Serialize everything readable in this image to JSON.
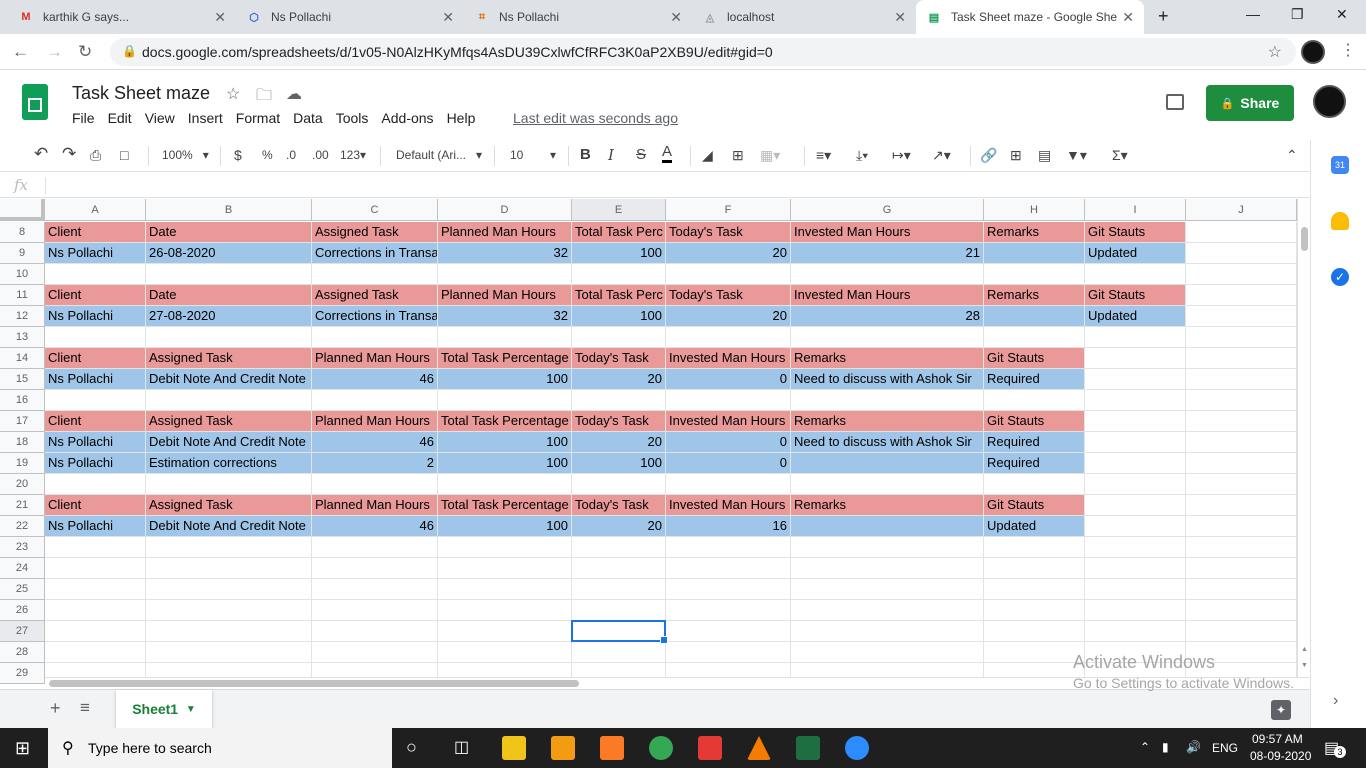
{
  "browser": {
    "tabs": [
      {
        "title": "karthik G says...",
        "fav": "M",
        "favcolor": "#d93025"
      },
      {
        "title": "Ns Pollachi",
        "fav": "⬡",
        "favcolor": "#3367d6"
      },
      {
        "title": "Ns Pollachi",
        "fav": "⌗",
        "favcolor": "#e8710a"
      },
      {
        "title": "localhost",
        "fav": "◬",
        "favcolor": "#9aa0a6"
      },
      {
        "title": "Task Sheet maze - Google She",
        "fav": "▤",
        "favcolor": "#0f9d58"
      }
    ],
    "url": "docs.google.com/spreadsheets/d/1v05-N0AlzHKyMfqs4AsDU39CxlwfCfRFC3K0aP2XB9U/edit#gid=0"
  },
  "app": {
    "title": "Task Sheet maze",
    "menu": [
      "File",
      "Edit",
      "View",
      "Insert",
      "Format",
      "Data",
      "Tools",
      "Add-ons",
      "Help"
    ],
    "last_edit": "Last edit was seconds ago",
    "share_label": "Share"
  },
  "toolbar": {
    "zoom": "100%",
    "currency": "$",
    "percent": "%",
    "dec_less": ".0",
    "dec_more": ".00",
    "num_format": "123",
    "font": "Default (Ari...",
    "font_size": "10",
    "bold": "B",
    "italic": "I",
    "strike": "S",
    "text_color": "A"
  },
  "formula_bar": {
    "label": "fx",
    "value": ""
  },
  "columns": [
    "A",
    "B",
    "C",
    "D",
    "E",
    "F",
    "G",
    "H",
    "I",
    "J"
  ],
  "rows": [
    {
      "n": "8",
      "style": "pink9",
      "cells": [
        "Client",
        "Date",
        "Assigned Task",
        "Planned Man Hours",
        "Total Task Perc",
        "Today's Task",
        "Invested Man Hours",
        "Remarks",
        "Git Stauts"
      ]
    },
    {
      "n": "9",
      "style": "blue9",
      "cells": [
        "Ns Pollachi",
        "26-08-2020",
        "Corrections in Transa",
        "32",
        "100",
        "20",
        "21",
        "",
        "Updated"
      ]
    },
    {
      "n": "10",
      "style": "empty",
      "cells": []
    },
    {
      "n": "11",
      "style": "pink9",
      "cells": [
        "Client",
        "Date",
        "Assigned Task",
        "Planned Man Hours",
        "Total Task Perc",
        "Today's Task",
        "Invested Man Hours",
        "Remarks",
        "Git Stauts"
      ]
    },
    {
      "n": "12",
      "style": "blue9",
      "cells": [
        "Ns Pollachi",
        "27-08-2020",
        "Corrections in Transa",
        "32",
        "100",
        "20",
        "28",
        "",
        "Updated"
      ]
    },
    {
      "n": "13",
      "style": "empty",
      "cells": []
    },
    {
      "n": "14",
      "style": "pink8",
      "cells": [
        "Client",
        "Assigned Task",
        "Planned Man Hours",
        "Total Task Percentage",
        "Today's Task",
        "Invested Man Hours",
        "Remarks",
        "Git Stauts"
      ]
    },
    {
      "n": "15",
      "style": "blue8",
      "cells": [
        "Ns Pollachi",
        "Debit Note And Credit Note",
        "46",
        "100",
        "20",
        "0",
        "Need to discuss with Ashok Sir",
        "Required"
      ]
    },
    {
      "n": "16",
      "style": "empty",
      "cells": []
    },
    {
      "n": "17",
      "style": "pink8",
      "cells": [
        "Client",
        "Assigned Task",
        "Planned Man Hours",
        "Total Task Percentage",
        "Today's Task",
        "Invested Man Hours",
        "Remarks",
        "Git Stauts"
      ]
    },
    {
      "n": "18",
      "style": "blue8",
      "cells": [
        "Ns Pollachi",
        "Debit Note And Credit Note",
        "46",
        "100",
        "20",
        "0",
        "Need to discuss with Ashok Sir",
        "Required"
      ]
    },
    {
      "n": "19",
      "style": "blue8",
      "cells": [
        "Ns Pollachi",
        "Estimation corrections",
        "2",
        "100",
        "100",
        "0",
        "",
        "Required"
      ]
    },
    {
      "n": "20",
      "style": "empty",
      "cells": []
    },
    {
      "n": "21",
      "style": "pink8",
      "cells": [
        "Client",
        "Assigned Task",
        "Planned Man Hours",
        "Total Task Percentage",
        "Today's Task",
        "Invested Man Hours",
        "Remarks",
        "Git Stauts"
      ]
    },
    {
      "n": "22",
      "style": "blue8",
      "cells": [
        "Ns Pollachi",
        "Debit Note And Credit Note",
        "46",
        "100",
        "20",
        "16",
        "",
        "Updated"
      ]
    },
    {
      "n": "23",
      "style": "empty",
      "cells": []
    },
    {
      "n": "24",
      "style": "empty",
      "cells": []
    },
    {
      "n": "25",
      "style": "empty",
      "cells": []
    },
    {
      "n": "26",
      "style": "empty",
      "cells": []
    },
    {
      "n": "27",
      "style": "empty",
      "cells": []
    },
    {
      "n": "28",
      "style": "empty",
      "cells": []
    },
    {
      "n": "29",
      "style": "empty",
      "cells": []
    }
  ],
  "sheet_tab": "Sheet1",
  "watermark": {
    "title": "Activate Windows",
    "subtitle": "Go to Settings to activate Windows."
  },
  "taskbar": {
    "search_placeholder": "Type here to search",
    "lang": "ENG",
    "time": "09:57 AM",
    "date": "08-09-2020",
    "notifications": "3"
  },
  "colors": {
    "header_row": "#ea9999",
    "data_row": "#9fc5e8",
    "accent": "#1a73e8",
    "share": "#1e8e3e"
  }
}
